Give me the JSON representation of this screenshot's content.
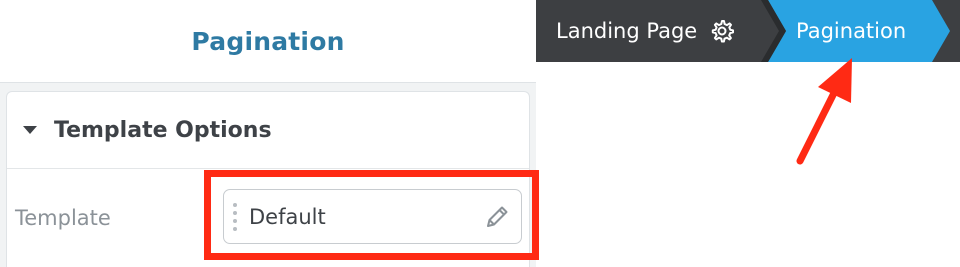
{
  "panel": {
    "title": "Pagination",
    "section": {
      "title": "Template Options",
      "field_label": "Template",
      "field_value": "Default"
    }
  },
  "breadcrumb": {
    "items": [
      {
        "label": "Landing Page"
      },
      {
        "label": "Pagination"
      }
    ]
  },
  "colors": {
    "title_blue": "#2e7aa3",
    "breadcrumb_bg": "#3d3f42",
    "active_crumb": "#29a3e2",
    "highlight_red": "#ff2a14"
  },
  "icons": {
    "caret": "caret-down-icon",
    "drag": "drag-handle-icon",
    "edit": "pencil-icon",
    "settings": "gear-icon"
  }
}
